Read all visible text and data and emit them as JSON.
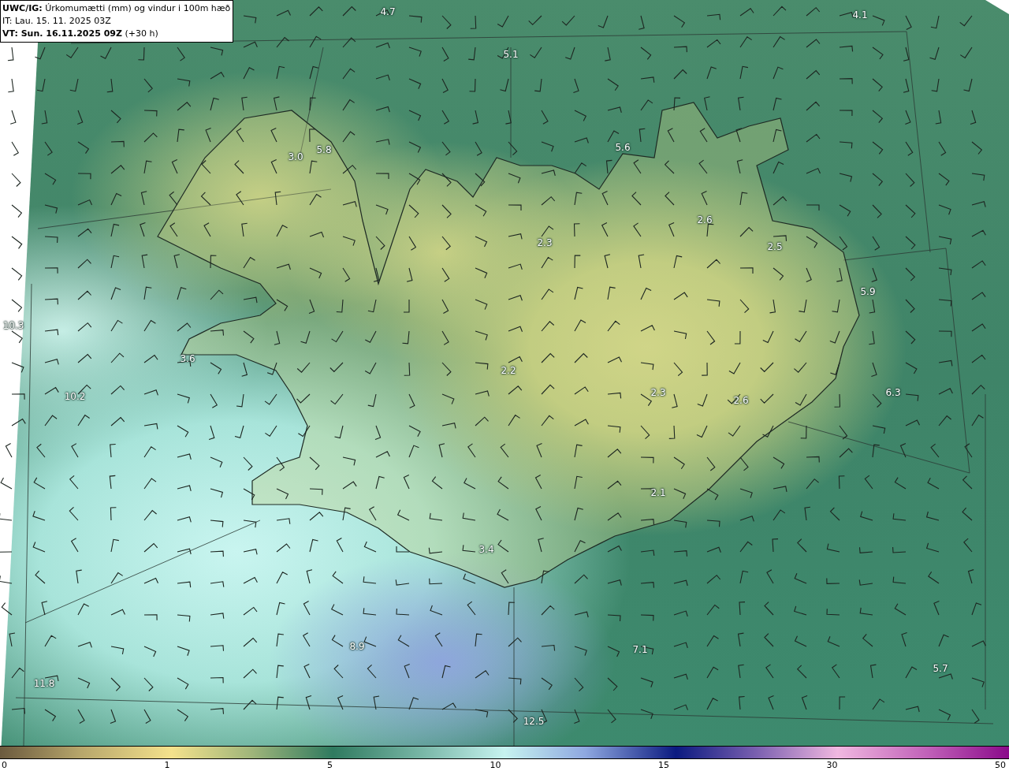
{
  "header": {
    "title": "**UWC/IG:** Úrkomumætti (mm) og vindur i 100m hæð",
    "issue_time": "IT: Lau. 15. 11. 2025 03Z",
    "valid_time": "**VT: Sun. 16.11.2025 09Z** (+30 h)"
  },
  "map_labels": [
    "4.7",
    "4.1",
    "5.1",
    "3.0",
    "5.8",
    "5.6",
    "2.6",
    "2.3",
    "2.5",
    "5.9",
    "10.3",
    "3.6",
    "2.2",
    "2.3",
    "2.6",
    "6.3",
    "10.2",
    "2.1",
    "3.4",
    "8.9",
    "7.1",
    "5.7",
    "11.8",
    "12.5"
  ],
  "colorbar": {
    "ticks": [
      "0",
      "1",
      "5",
      "10",
      "15",
      "30",
      "50"
    ]
  }
}
